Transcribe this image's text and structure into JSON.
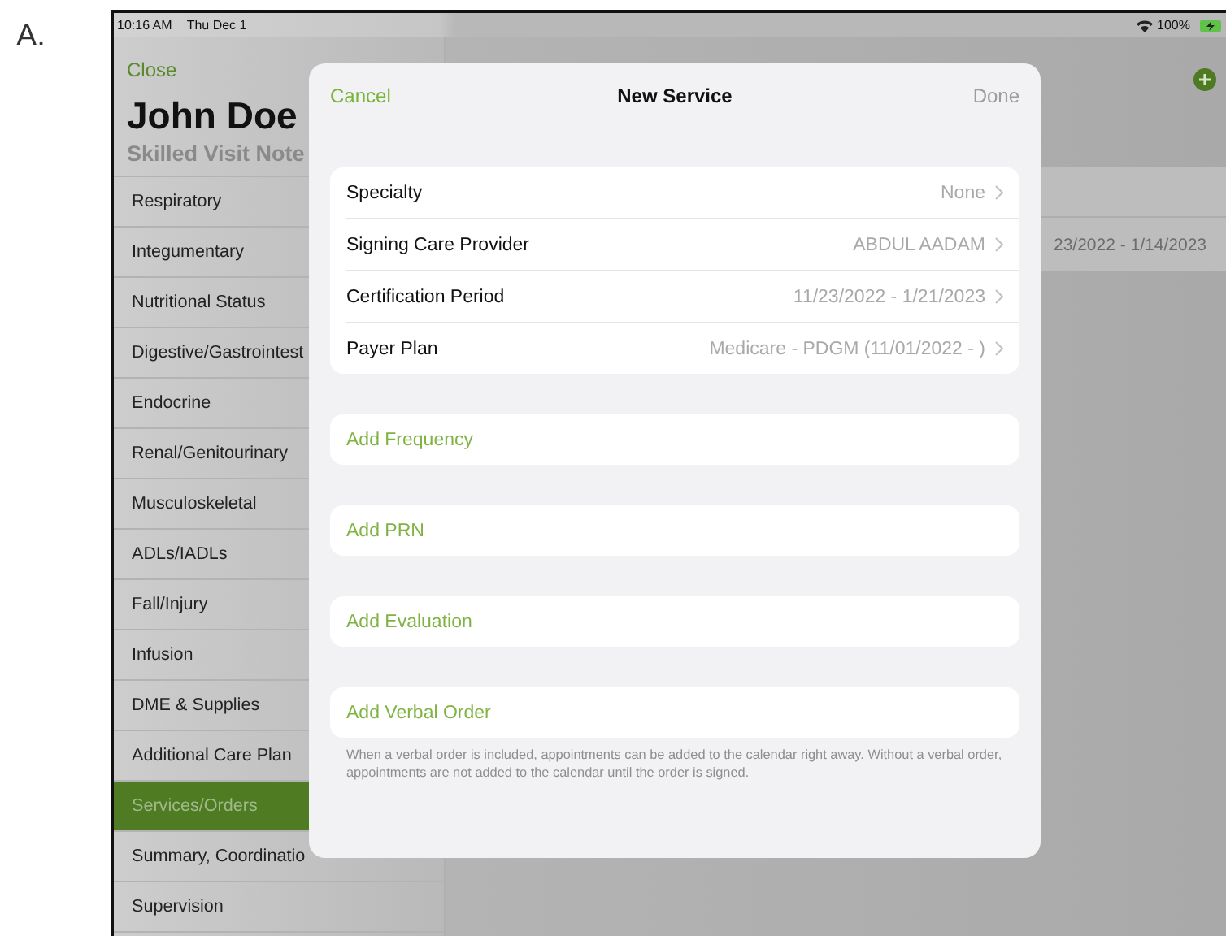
{
  "figure_label": "A.",
  "status_bar": {
    "time": "10:16 AM",
    "date": "Thu Dec 1",
    "battery": "100%",
    "charging": true
  },
  "sidebar": {
    "close": "Close",
    "patient": "John Doe",
    "note_type": "Skilled Visit Note",
    "items": [
      {
        "label": "Respiratory",
        "selected": false
      },
      {
        "label": "Integumentary",
        "selected": false
      },
      {
        "label": "Nutritional Status",
        "selected": false
      },
      {
        "label": "Digestive/Gastrointest",
        "selected": false
      },
      {
        "label": "Endocrine",
        "selected": false
      },
      {
        "label": "Renal/Genitourinary",
        "selected": false
      },
      {
        "label": "Musculoskeletal",
        "selected": false
      },
      {
        "label": "ADLs/IADLs",
        "selected": false
      },
      {
        "label": "Fall/Injury",
        "selected": false
      },
      {
        "label": "Infusion",
        "selected": false
      },
      {
        "label": "DME & Supplies",
        "selected": false
      },
      {
        "label": "Additional Care Plan",
        "selected": false
      },
      {
        "label": "Services/Orders",
        "selected": true
      },
      {
        "label": "Summary, Coordinatio",
        "selected": false
      },
      {
        "label": "Supervision",
        "selected": false
      }
    ]
  },
  "detail": {
    "card_text": "23/2022 - 1/14/2023"
  },
  "modal": {
    "cancel": "Cancel",
    "title": "New Service",
    "done": {
      "label": "Done",
      "disabled": true
    },
    "fields": [
      {
        "label": "Specialty",
        "value": "None"
      },
      {
        "label": "Signing Care Provider",
        "value": "ABDUL AADAM"
      },
      {
        "label": "Certification Period",
        "value": "11/23/2022 - 1/21/2023"
      },
      {
        "label": "Payer Plan",
        "value": "Medicare - PDGM (11/01/2022 - )"
      }
    ],
    "actions": [
      {
        "label": "Add Frequency"
      },
      {
        "label": "Add PRN"
      },
      {
        "label": "Add Evaluation"
      },
      {
        "label": "Add Verbal Order"
      }
    ],
    "note": "When a verbal order is included, appointments can be added to the calendar right away. Without a verbal order, appointments are not added to the calendar until the order is signed."
  }
}
